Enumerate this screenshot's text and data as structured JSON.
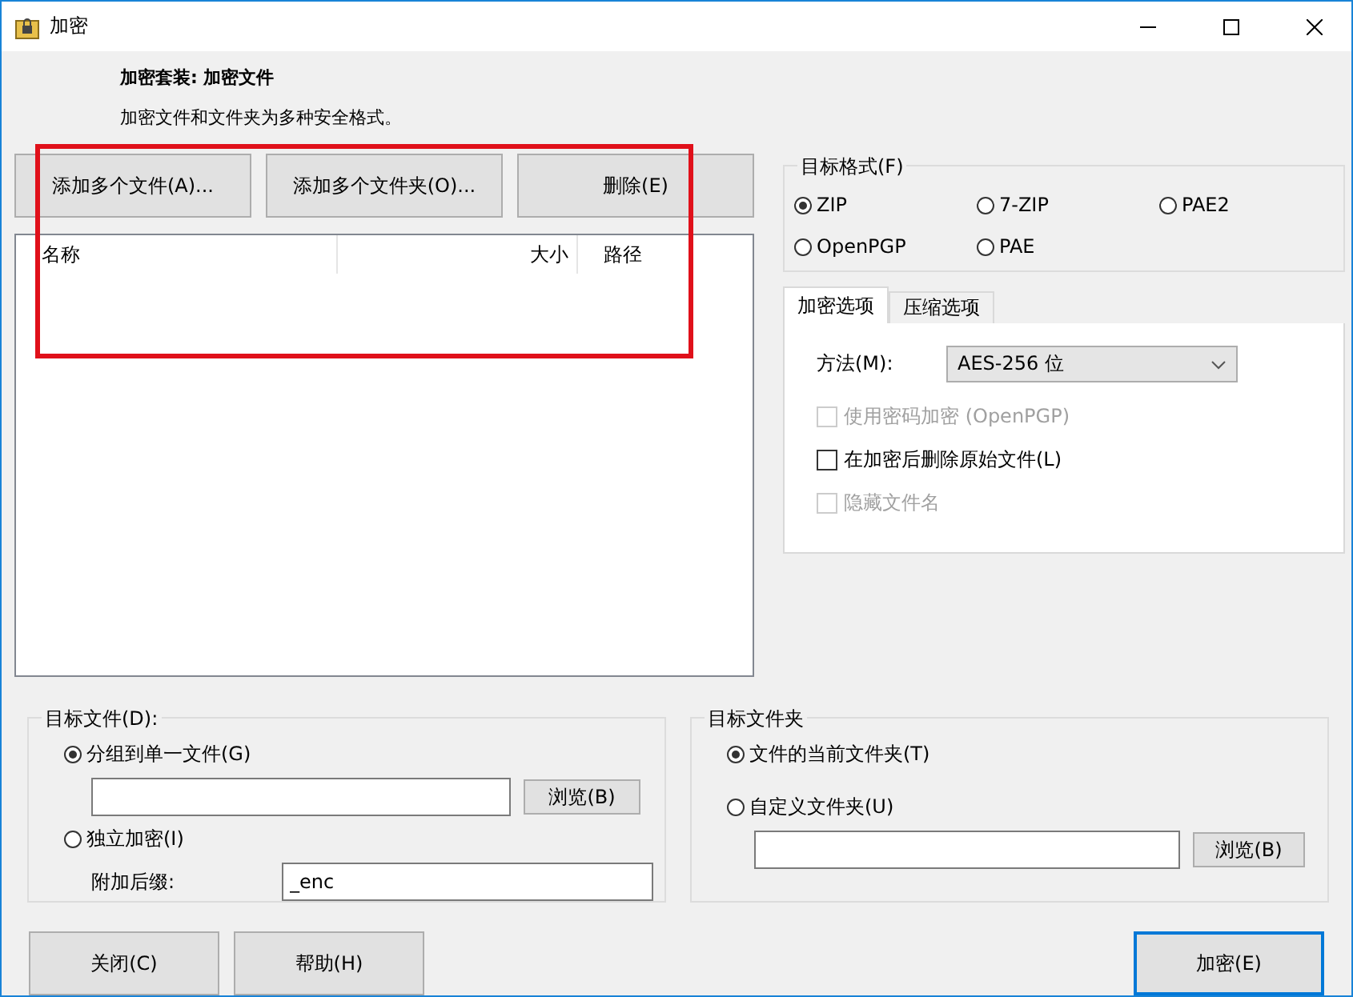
{
  "window": {
    "title": "加密"
  },
  "header": {
    "title": "加密套装: 加密文件",
    "subtitle": "加密文件和文件夹为多种安全格式。"
  },
  "file_buttons": [
    "添加多个文件(A)...",
    "添加多个文件夹(O)...",
    "删除(E)"
  ],
  "file_list": {
    "columns": [
      "名称",
      "大小",
      "路径"
    ]
  },
  "target_format": {
    "label": "目标格式(F)",
    "options": [
      {
        "label": "ZIP",
        "selected": true
      },
      {
        "label": "7-ZIP",
        "selected": false
      },
      {
        "label": "PAE2",
        "selected": false
      },
      {
        "label": "OpenPGP",
        "selected": false
      },
      {
        "label": "PAE",
        "selected": false
      }
    ]
  },
  "tabs": [
    {
      "label": "加密选项",
      "selected": true
    },
    {
      "label": "压缩选项",
      "selected": false
    }
  ],
  "encryption_options": {
    "method_label": "方法(M):",
    "method_value": "AES-256 位",
    "checkboxes": [
      {
        "label": "使用密码加密 (OpenPGP)",
        "checked": false,
        "disabled": true
      },
      {
        "label": "在加密后删除原始文件(L)",
        "checked": false,
        "disabled": false
      },
      {
        "label": "隐藏文件名",
        "checked": false,
        "disabled": true
      }
    ]
  },
  "target_file": {
    "label": "目标文件(D):",
    "options": [
      {
        "label": "分组到单一文件(G)",
        "selected": true
      },
      {
        "label": "独立加密(I)",
        "selected": false
      }
    ],
    "browse_button": "浏览(B)",
    "suffix_label": "附加后缀:",
    "suffix_value": "_enc"
  },
  "target_folder": {
    "label": "目标文件夹",
    "options": [
      {
        "label": "文件的当前文件夹(T)",
        "selected": true
      },
      {
        "label": "自定义文件夹(U)",
        "selected": false
      }
    ],
    "browse_button": "浏览(B)"
  },
  "buttons": [
    {
      "label": "关闭(C)",
      "default": false
    },
    {
      "label": "帮助(H)",
      "default": false
    },
    {
      "label": "加密(E)",
      "default": true
    }
  ],
  "annotation": {
    "kind": "highlight-rectangle"
  }
}
